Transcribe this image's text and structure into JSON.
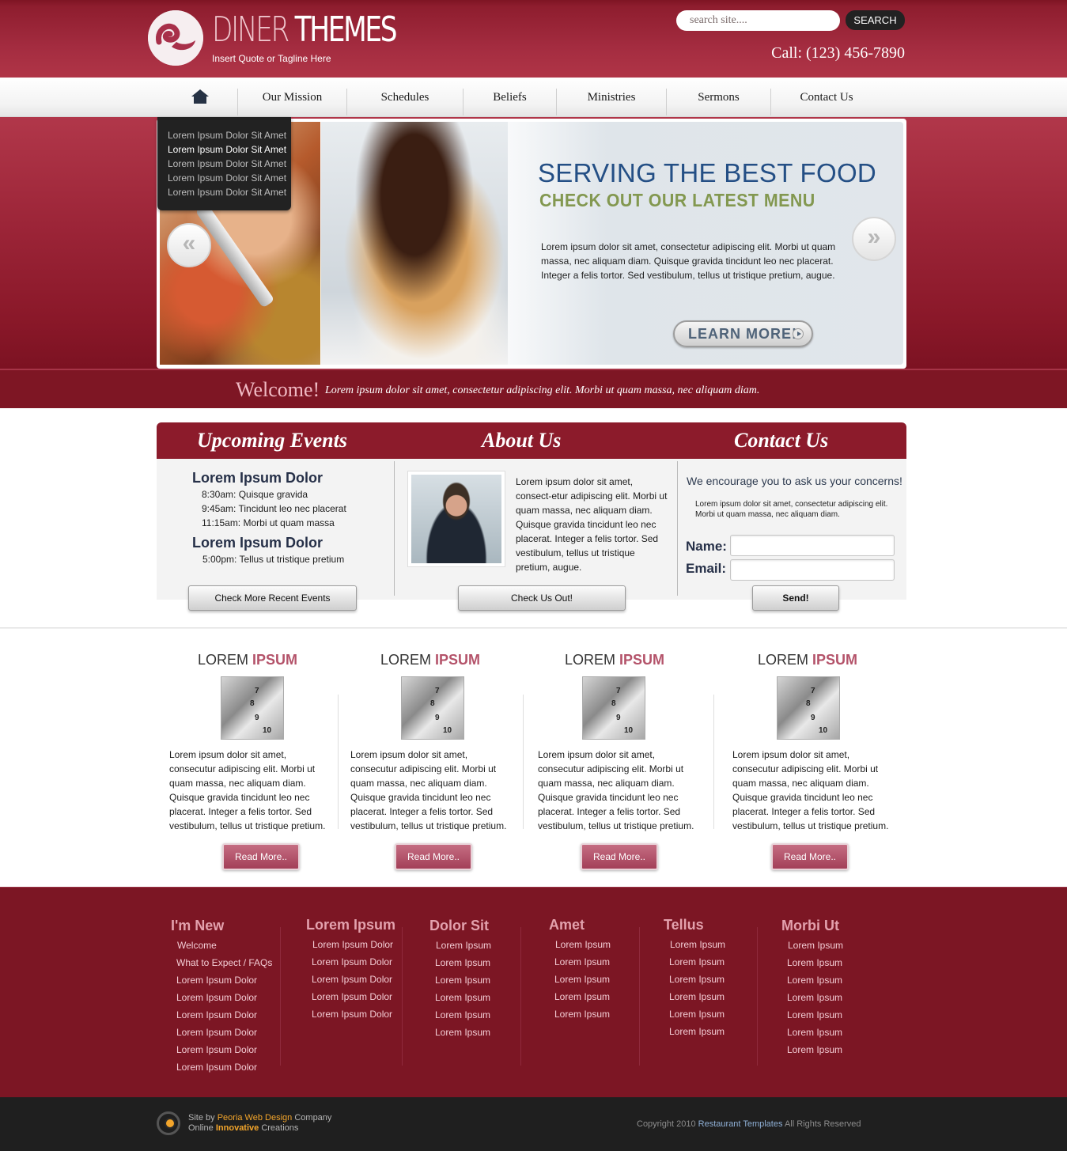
{
  "header": {
    "logo_text_thin": "DINER",
    "logo_text_bold": "THEMES",
    "tagline": "Insert Quote or Tagline Here",
    "search_placeholder": "search site....",
    "search_button": "SEARCH",
    "phone": "Call: (123) 456-7890"
  },
  "nav": {
    "home_icon": "home-icon",
    "items": [
      "Our Mission",
      "Schedules",
      "Beliefs",
      "Ministries",
      "Sermons",
      "Contact Us"
    ]
  },
  "slider": {
    "menu_items": [
      "Lorem Ipsum Dolor Sit Amet",
      "Lorem Ipsum Dolor Sit Amet",
      "Lorem Ipsum Dolor Sit Amet",
      "Lorem Ipsum Dolor Sit Amet",
      "Lorem Ipsum Dolor Sit Amet"
    ],
    "title": "SERVING THE BEST FOOD",
    "subtitle": "CHECK OUT OUR LATEST MENU",
    "text": "Lorem ipsum dolor sit amet, consectetur adipiscing elit. Morbi ut quam massa, nec aliquam diam. Quisque gravida tincidunt leo nec placerat. Integer a felis tortor. Sed vestibulum, tellus ut tristique pretium, augue.",
    "button": "LEARN MORE!",
    "prev": "«",
    "next": "»"
  },
  "welcome": {
    "title": "Welcome!",
    "text": "Lorem ipsum dolor sit amet, consectetur adipiscing elit. Morbi ut quam massa, nec aliquam diam."
  },
  "events": {
    "title": "Upcoming Events",
    "groups": [
      {
        "heading": "Lorem Ipsum Dolor",
        "lines": [
          "8:30am: Quisque gravida",
          "9:45am: Tincidunt leo nec placerat",
          "11:15am: Morbi ut quam massa"
        ]
      },
      {
        "heading": "Lorem Ipsum Dolor",
        "lines": [
          "5:00pm: Tellus ut tristique pretium"
        ]
      }
    ],
    "button": "Check More Recent Events"
  },
  "about": {
    "title": "About Us",
    "text": "Lorem ipsum dolor sit amet, consect-etur adipiscing elit. Morbi ut quam massa, nec aliquam diam. Quisque gravida tincidunt leo nec placerat. Integer a felis tortor. Sed vestibulum, tellus ut tristique pretium, augue.",
    "button": "Check Us Out!"
  },
  "contact": {
    "title": "Contact Us",
    "intro": "We encourage you to ask us your concerns!",
    "small": "Lorem ipsum dolor sit amet, consectetur adipiscing elit. Morbi ut quam massa, nec aliquam diam.",
    "name_label": "Name:",
    "email_label": "Email:",
    "button": "Send!"
  },
  "features": {
    "items": [
      {
        "title_plain": "LOREM",
        "title_accent": "IPSUM",
        "text": "Lorem ipsum dolor sit amet, consecutur adipiscing elit. Morbi ut quam massa, nec aliquam diam. Quisque gravida tincidunt leo nec placerat. Integer a felis tortor. Sed vestibulum, tellus ut tristique pretium.",
        "button": "Read More.."
      },
      {
        "title_plain": "LOREM",
        "title_accent": "IPSUM",
        "text": "Lorem ipsum dolor sit amet, consecutur adipiscing elit. Morbi ut quam massa, nec aliquam diam. Quisque gravida tincidunt leo nec placerat. Integer a felis tortor. Sed vestibulum, tellus ut tristique pretium.",
        "button": "Read More.."
      },
      {
        "title_plain": "LOREM",
        "title_accent": "IPSUM",
        "text": "Lorem ipsum dolor sit amet, consecutur adipiscing elit. Morbi ut quam massa, nec aliquam diam. Quisque gravida tincidunt leo nec placerat. Integer a felis tortor. Sed vestibulum, tellus ut tristique pretium.",
        "button": "Read More.."
      },
      {
        "title_plain": "LOREM",
        "title_accent": "IPSUM",
        "text": "Lorem ipsum dolor sit amet, consecutur adipiscing elit. Morbi ut quam massa, nec aliquam diam. Quisque gravida tincidunt leo nec placerat. Integer a felis tortor. Sed vestibulum, tellus ut tristique pretium.",
        "button": "Read More.."
      }
    ],
    "image_numbers": [
      "7",
      "8",
      "9",
      "10"
    ]
  },
  "footer": {
    "columns": [
      {
        "heading": "I'm New",
        "links": [
          "Welcome",
          "What to Expect / FAQs",
          "Lorem Ipsum Dolor",
          "Lorem Ipsum Dolor",
          "Lorem Ipsum Dolor",
          "Lorem Ipsum Dolor",
          "Lorem Ipsum Dolor",
          "Lorem Ipsum Dolor"
        ]
      },
      {
        "heading": "Lorem Ipsum",
        "links": [
          "Lorem Ipsum Dolor",
          "Lorem Ipsum Dolor",
          "Lorem Ipsum Dolor",
          "Lorem Ipsum Dolor",
          "Lorem Ipsum Dolor"
        ]
      },
      {
        "heading": "Dolor Sit",
        "links": [
          "Lorem Ipsum",
          "Lorem Ipsum",
          "Lorem Ipsum",
          "Lorem Ipsum",
          "Lorem Ipsum",
          "Lorem Ipsum"
        ]
      },
      {
        "heading": "Amet",
        "links": [
          "Lorem Ipsum",
          "Lorem Ipsum",
          "Lorem Ipsum",
          "Lorem Ipsum",
          "Lorem Ipsum"
        ]
      },
      {
        "heading": "Tellus",
        "links": [
          "Lorem Ipsum",
          "Lorem Ipsum",
          "Lorem Ipsum",
          "Lorem Ipsum",
          "Lorem Ipsum",
          "Lorem Ipsum"
        ]
      },
      {
        "heading": "Morbi Ut",
        "links": [
          "Lorem Ipsum",
          "Lorem Ipsum",
          "Lorem Ipsum",
          "Lorem Ipsum",
          "Lorem Ipsum",
          "Lorem Ipsum",
          "Lorem Ipsum"
        ]
      }
    ],
    "credit_site_by": "Site by",
    "credit_company_link": "Peoria Web Design",
    "credit_company": "Company",
    "credit_online": "Online",
    "credit_innovative": "Innovative",
    "credit_creations": "Creations",
    "copyright_prefix": "Copyright 2010",
    "copyright_link": "Restaurant Templates",
    "copyright_suffix": "All Rights Reserved"
  }
}
